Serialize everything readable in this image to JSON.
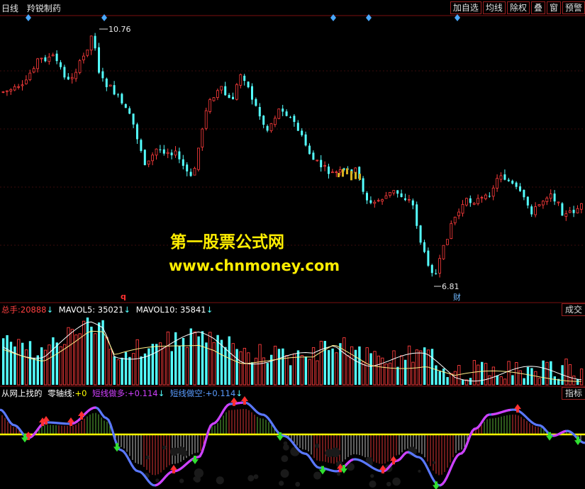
{
  "header": {
    "period": "日线",
    "stock_name": "羚锐制药"
  },
  "toolbar": [
    "加自选",
    "均线",
    "除权",
    "叠",
    "窗",
    "预警"
  ],
  "price": {
    "high_label": "10.76",
    "low_label": "6.81",
    "q_mark": "q",
    "fin_mark": "财"
  },
  "watermark": {
    "line1": "第一股票公式网",
    "line2": "www.chnmoney.com"
  },
  "volume": {
    "label": "总手:",
    "value": "20888",
    "mavol5_label": "MAVOL5:",
    "mavol5": "35021",
    "mavol10_label": "MAVOL10:",
    "mavol10": "35841",
    "arrow": "↓",
    "tag": "成交"
  },
  "indicator": {
    "label": "从网上找的",
    "zero_label": "零轴线:",
    "zero": "+0",
    "long_label": "短线做多:",
    "long": "+0.114",
    "short_label": "短线做空:",
    "short": "+0.114",
    "arrow": "↓",
    "tag": "指标"
  },
  "colors": {
    "up": "#ff3c3c",
    "down": "#54ffff",
    "ma": "#ffffff",
    "zero_line": "#ffff00",
    "curve_main": "#5a78ff",
    "curve_alt": "#d040ff",
    "accent_border": "#9a2020"
  }
}
